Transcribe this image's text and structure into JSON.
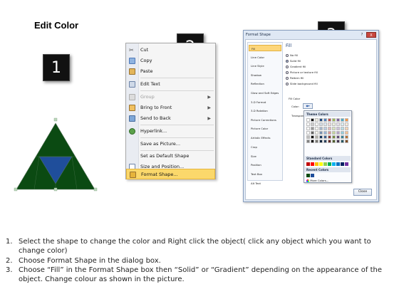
{
  "title": "Edit Color",
  "badges": [
    "1",
    "2",
    "3"
  ],
  "context_menu": {
    "items": [
      {
        "label": "Cut",
        "icon": "cut-icon",
        "disabled": false,
        "submenu": false
      },
      {
        "label": "Copy",
        "icon": "copy-icon",
        "disabled": false,
        "submenu": false
      },
      {
        "label": "Paste",
        "icon": "paste-icon",
        "disabled": false,
        "submenu": false
      },
      {
        "label": "Edit Text",
        "icon": "edit-text-icon",
        "disabled": false,
        "submenu": false
      },
      {
        "label": "Group",
        "icon": "group-icon",
        "disabled": true,
        "submenu": true
      },
      {
        "label": "Bring to Front",
        "icon": "bring-front-icon",
        "disabled": false,
        "submenu": true
      },
      {
        "label": "Send to Back",
        "icon": "send-back-icon",
        "disabled": false,
        "submenu": true
      },
      {
        "label": "Hyperlink...",
        "icon": "hyperlink-icon",
        "disabled": false,
        "submenu": false
      },
      {
        "label": "Save as Picture...",
        "icon": "",
        "disabled": false,
        "submenu": false
      },
      {
        "label": "Set as Default Shape",
        "icon": "",
        "disabled": false,
        "submenu": false
      },
      {
        "label": "Size and Position...",
        "icon": "size-icon",
        "disabled": false,
        "submenu": false
      },
      {
        "label": "Format Shape...",
        "icon": "format-shape-icon",
        "disabled": false,
        "submenu": false,
        "highlighted": true
      }
    ]
  },
  "dialog": {
    "title": "Format Shape",
    "help": "?",
    "close_x": "X",
    "sidebar": [
      "Fill",
      "Line Color",
      "Line Style",
      "Shadow",
      "Reflection",
      "Glow and Soft Edges",
      "3-D Format",
      "3-D Rotation",
      "Picture Corrections",
      "Picture Color",
      "Artistic Effects",
      "Crop",
      "Size",
      "Position",
      "Text Box",
      "Alt Text"
    ],
    "selected_sidebar": "Fill",
    "fill_heading": "Fill",
    "fill_options": [
      "No fill",
      "Solid fill",
      "Gradient fill",
      "Picture or texture fill",
      "Pattern fill",
      "Slide background fill"
    ],
    "selected_fill": "Solid fill",
    "fill_color_label": "Fill Color",
    "color_label": "Color:",
    "transparency_label": "Transparency:",
    "palette": {
      "theme_title": "Theme Colors",
      "standard_title": "Standard Colors",
      "recent_title": "Recent Colors",
      "more_colors": "More Colors...",
      "theme_top": [
        "#ffffff",
        "#000000",
        "#eeece1",
        "#1f497d",
        "#4f81bd",
        "#c0504d",
        "#9bbb59",
        "#8064a2",
        "#4bacc6",
        "#f79646"
      ],
      "standard": [
        "#c00000",
        "#ff0000",
        "#ffc000",
        "#ffff00",
        "#92d050",
        "#00b050",
        "#00b0f0",
        "#0070c0",
        "#002060",
        "#7030a0"
      ],
      "recent": [
        "#0b4a12",
        "#1f4e9b"
      ]
    },
    "close_button": "Close"
  },
  "instructions": [
    {
      "num": "1.",
      "text": "Select the shape to change the color and Right click the object( click any object which you want to change color)"
    },
    {
      "num": "2.",
      "text": "Choose Format Shape in the dialog box."
    },
    {
      "num": "3.",
      "text": "Choose “Fill” in the Format Shape box then “Solid” or “Gradient” depending on the appearance of the object. Change colour as shown in the picture."
    }
  ],
  "colors": {
    "pyramid_green": "#0b4a12",
    "pyramid_blue": "#1f4e9b",
    "menu_highlight": "#fbd86b"
  }
}
